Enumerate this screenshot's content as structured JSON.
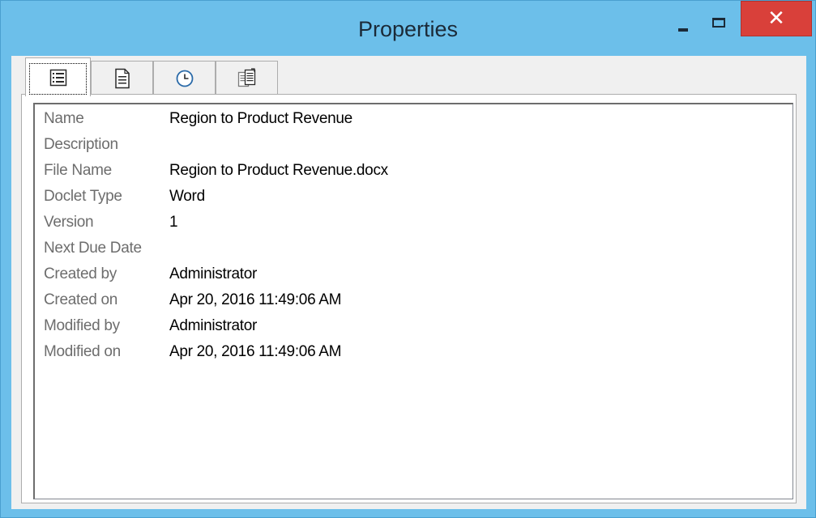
{
  "window": {
    "title": "Properties",
    "minimize_glyph": "–",
    "maximize_glyph": "☐",
    "close_glyph": "✕",
    "colors": {
      "frame": "#6cbfea",
      "close": "#d9403a"
    }
  },
  "tabs": [
    {
      "icon": "details-list-icon",
      "active": true
    },
    {
      "icon": "document-icon",
      "active": false
    },
    {
      "icon": "clock-icon",
      "active": false
    },
    {
      "icon": "copy-document-icon",
      "active": false
    }
  ],
  "properties": {
    "rows": [
      {
        "label": "Name",
        "value": "Region to Product Revenue"
      },
      {
        "label": "Description",
        "value": ""
      },
      {
        "label": "File Name",
        "value": "Region to Product Revenue.docx"
      },
      {
        "label": "Doclet Type",
        "value": "Word"
      },
      {
        "label": "Version",
        "value": "1"
      },
      {
        "label": "Next Due Date",
        "value": ""
      },
      {
        "label": "Created by",
        "value": "Administrator"
      },
      {
        "label": "Created on",
        "value": "Apr 20, 2016 11:49:06 AM"
      },
      {
        "label": "Modified by",
        "value": "Administrator"
      },
      {
        "label": "Modified on",
        "value": "Apr 20, 2016 11:49:06 AM"
      }
    ]
  }
}
